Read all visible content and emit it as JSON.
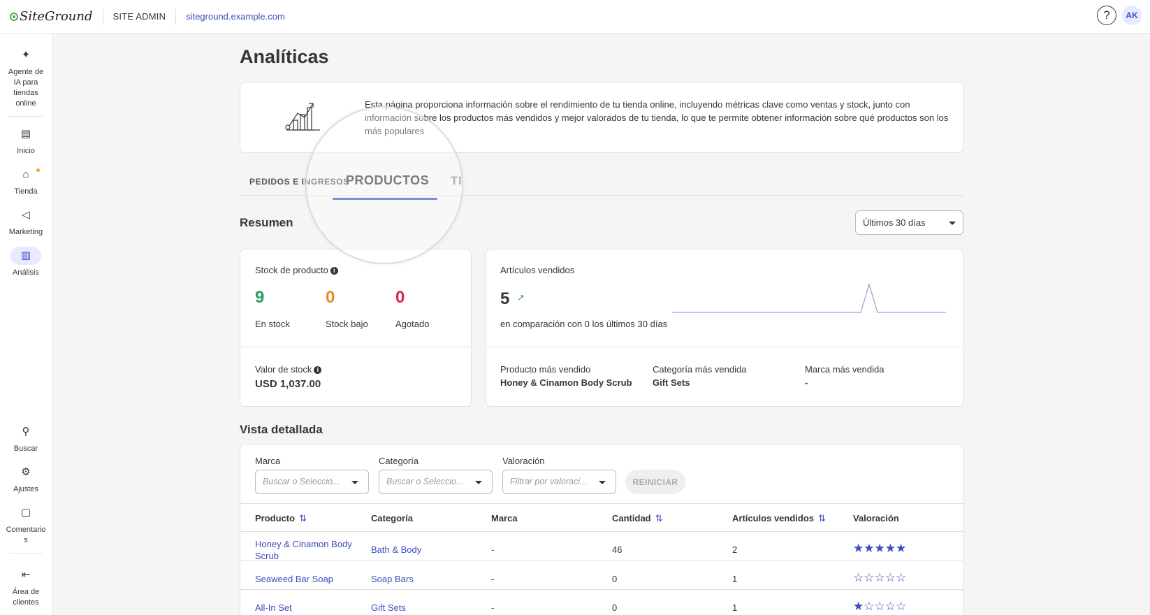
{
  "topbar": {
    "logo": "SiteGround",
    "site_admin": "SITE ADMIN",
    "domain": "siteground.example.com",
    "help": "?",
    "avatar": "AK"
  },
  "sidebar": {
    "items": [
      {
        "label": "Agente de IA para tiendas online",
        "icon": "sparkle-icon"
      },
      {
        "label": "Inicio",
        "icon": "dashboard-icon"
      },
      {
        "label": "Tienda",
        "icon": "store-icon"
      },
      {
        "label": "Marketing",
        "icon": "megaphone-icon"
      },
      {
        "label": "Análisis",
        "icon": "chart-icon"
      },
      {
        "label": "Buscar",
        "icon": "search-icon"
      },
      {
        "label": "Ajustes",
        "icon": "gear-icon"
      },
      {
        "label": "Comentarios",
        "icon": "comment-icon"
      },
      {
        "label": "Área de clientes",
        "icon": "exit-icon"
      }
    ]
  },
  "page": {
    "title": "Analíticas",
    "intro": "Esta página proporciona información sobre el rendimiento de tu tienda online, incluyendo métricas clave como ventas y stock, junto con información sobre los productos más vendidos y mejor valorados de tu tienda, lo que te permite obtener información sobre qué productos son los más populares"
  },
  "tabs": {
    "pedidos": "PEDIDOS E INGRESOS",
    "productos": "PRODUCTOS",
    "third": "TI"
  },
  "summary": {
    "title": "Resumen",
    "period": "Últimos 30 días",
    "stock": {
      "label": "Stock de producto",
      "in_stock_value": "9",
      "in_stock_label": "En stock",
      "low_value": "0",
      "low_label": "Stock bajo",
      "out_value": "0",
      "out_label": "Agotado",
      "value_label": "Valor de stock",
      "value": "USD 1,037.00"
    },
    "sold": {
      "label": "Artículos vendidos",
      "value": "5",
      "comparison": "en comparación con 0 los últimos 30 días",
      "top_product_label": "Producto más vendido",
      "top_product": "Honey & Cinamon Body Scrub",
      "top_category_label": "Categoría más vendida",
      "top_category": "Gift Sets",
      "top_brand_label": "Marca más vendida",
      "top_brand": "-"
    }
  },
  "detail": {
    "title": "Vista detallada",
    "filters": {
      "brand_label": "Marca",
      "brand_placeholder": "Buscar o Seleccio...",
      "category_label": "Categoría",
      "category_placeholder": "Buscar o Seleccio...",
      "rating_label": "Valoración",
      "rating_placeholder": "Filtrar por valoraci...",
      "reset": "REINICIAR"
    },
    "columns": [
      "Producto",
      "Categoría",
      "Marca",
      "Cantidad",
      "Artículos vendidos",
      "Valoración"
    ],
    "rows": [
      {
        "product": "Honey & Cinamon Body Scrub",
        "category": "Bath & Body",
        "brand": "-",
        "quantity": "46",
        "sold": "2",
        "rating": 5
      },
      {
        "product": "Seaweed Bar Soap",
        "category": "Soap Bars",
        "brand": "-",
        "quantity": "0",
        "sold": "1",
        "rating": 0
      },
      {
        "product": "All-In Set",
        "category": "Gift Sets",
        "brand": "-",
        "quantity": "0",
        "sold": "1",
        "rating": 1
      }
    ]
  },
  "colors": {
    "accent": "#3b4dbf",
    "green": "#2e9e5b",
    "orange": "#e8892b",
    "red": "#d6254d"
  }
}
